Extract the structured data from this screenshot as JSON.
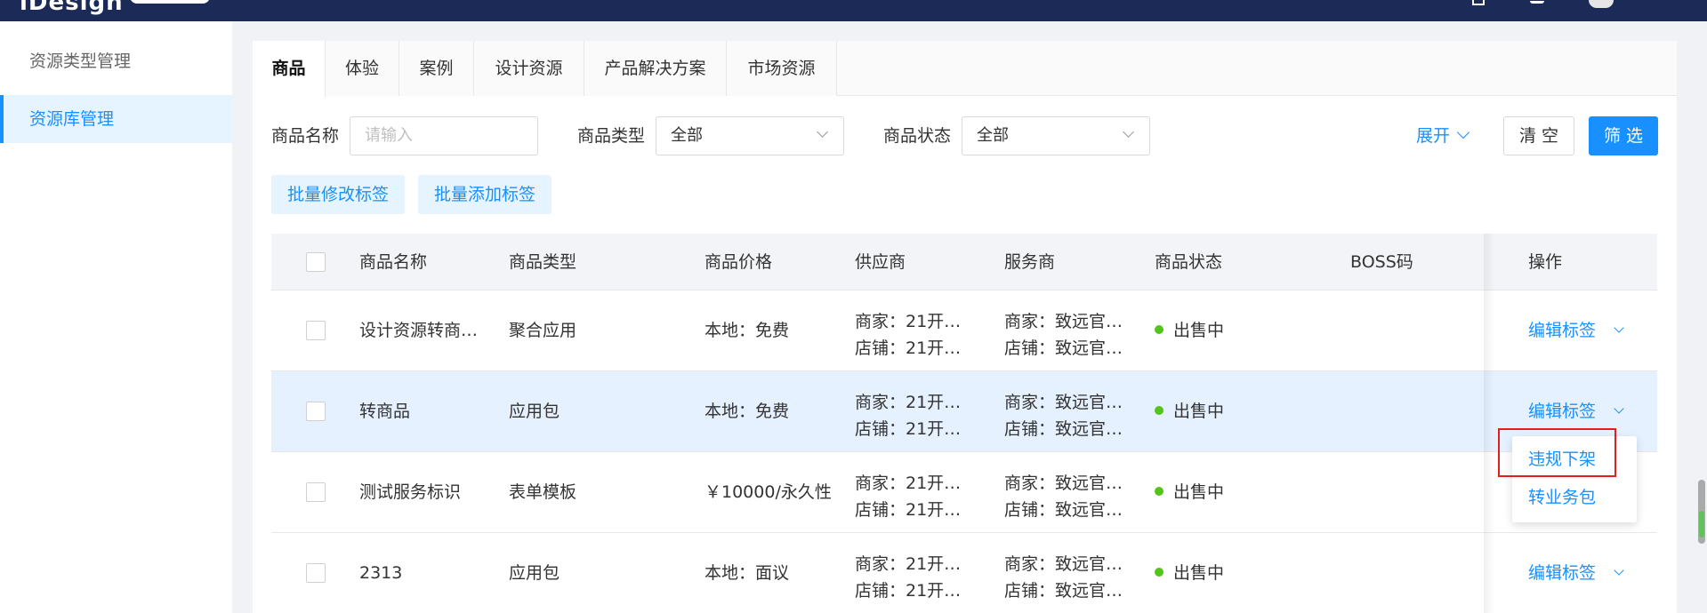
{
  "header": {
    "logo_text": "iDesign"
  },
  "sidebar": {
    "items": [
      {
        "label": "资源类型管理"
      },
      {
        "label": "资源库管理"
      }
    ]
  },
  "tabs": [
    {
      "label": "商品"
    },
    {
      "label": "体验"
    },
    {
      "label": "案例"
    },
    {
      "label": "设计资源"
    },
    {
      "label": "产品解决方案"
    },
    {
      "label": "市场资源"
    }
  ],
  "filters": {
    "name_label": "商品名称",
    "name_placeholder": "请输入",
    "type_label": "商品类型",
    "type_value": "全部",
    "status_label": "商品状态",
    "status_value": "全部",
    "expand_label": "展开",
    "clear_label": "清 空",
    "filter_label": "筛 选"
  },
  "batch": {
    "edit_tags": "批量修改标签",
    "add_tags": "批量添加标签"
  },
  "table": {
    "columns": [
      "商品名称",
      "商品类型",
      "商品价格",
      "供应商",
      "服务商",
      "商品状态",
      "BOSS码",
      "操作"
    ],
    "rows": [
      {
        "name": "设计资源转商…",
        "type": "聚合应用",
        "price": "本地：免费",
        "supplier_1": "商家：21开…",
        "supplier_2": "店铺：21开…",
        "provider_1": "商家：致远官…",
        "provider_2": "店铺：致远官…",
        "status": "出售中",
        "boss": "",
        "action": "编辑标签"
      },
      {
        "name": "转商品",
        "type": "应用包",
        "price": "本地：免费",
        "supplier_1": "商家：21开…",
        "supplier_2": "店铺：21开…",
        "provider_1": "商家：致远官…",
        "provider_2": "店铺：致远官…",
        "status": "出售中",
        "boss": "",
        "action": "编辑标签"
      },
      {
        "name": "测试服务标识",
        "type": "表单模板",
        "price": "￥10000/永久性",
        "supplier_1": "商家：21开…",
        "supplier_2": "店铺：21开…",
        "provider_1": "商家：致远官…",
        "provider_2": "店铺：致远官…",
        "status": "出售中",
        "boss": "",
        "action": ""
      },
      {
        "name": "2313",
        "type": "应用包",
        "price": "本地：面议",
        "supplier_1": "商家：21开…",
        "supplier_2": "店铺：21开…",
        "provider_1": "商家：致远官…",
        "provider_2": "店铺：致远官…",
        "status": "出售中",
        "boss": "",
        "action": "编辑标签"
      }
    ]
  },
  "dropdown": {
    "items": [
      {
        "label": "违规下架"
      },
      {
        "label": "转业务包"
      }
    ]
  },
  "colors": {
    "accent": "#1890ff",
    "topbar": "#1b2a56",
    "status_on_sale": "#52c41a",
    "highlight_box": "#e02020"
  }
}
